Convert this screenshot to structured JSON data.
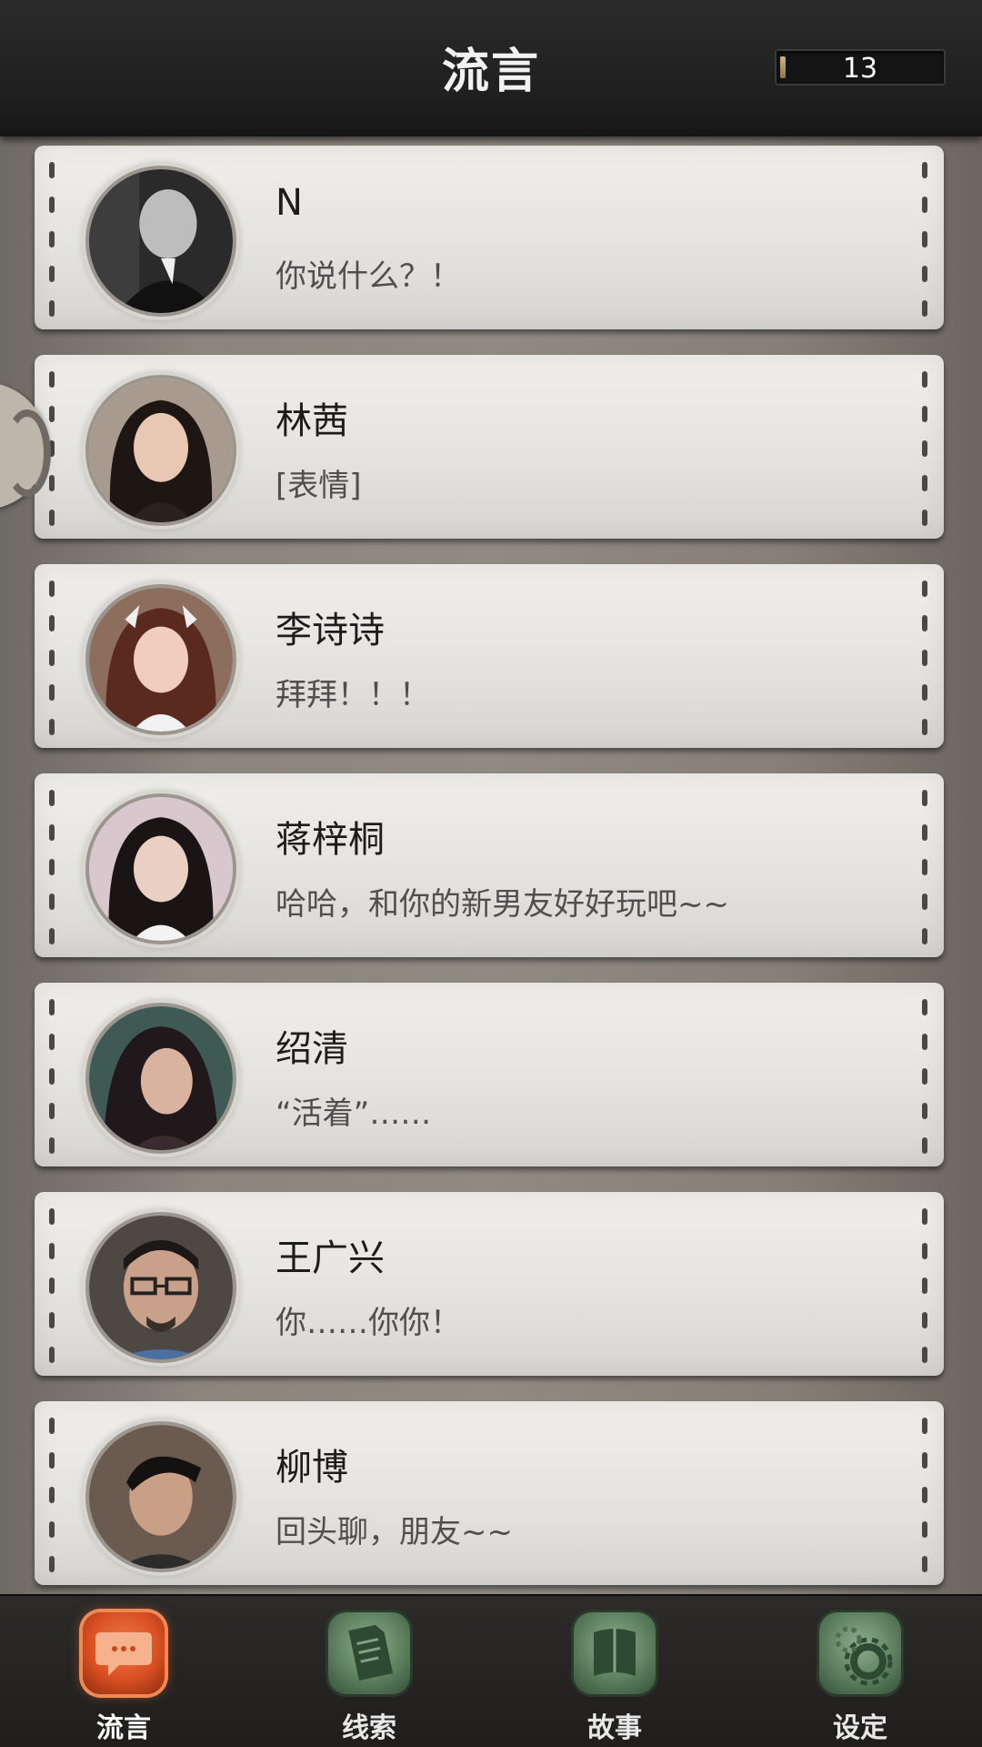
{
  "header": {
    "title": "流言",
    "counter_value": "13",
    "counter_fill": 0.03
  },
  "messages": [
    {
      "name": "N",
      "message": "你说什么？！",
      "avatar": "avatar-n"
    },
    {
      "name": "林茜",
      "message": "[表情]",
      "avatar": "avatar-lin-qian"
    },
    {
      "name": "李诗诗",
      "message": "拜拜！！！",
      "avatar": "avatar-li-shishi"
    },
    {
      "name": "蒋梓桐",
      "message": "哈哈，和你的新男友好好玩吧~~",
      "avatar": "avatar-jiang-zitong"
    },
    {
      "name": "绍清",
      "message": "“活着”……",
      "avatar": "avatar-shao-qing"
    },
    {
      "name": "王广兴",
      "message": "你……你你！",
      "avatar": "avatar-wang-guangxing"
    },
    {
      "name": "柳博",
      "message": "回头聊，朋友~~",
      "avatar": "avatar-liu-bo"
    }
  ],
  "nav": [
    {
      "label": "流言",
      "icon": "chat-bubble-icon",
      "active": true
    },
    {
      "label": "线索",
      "icon": "document-icon",
      "active": false
    },
    {
      "label": "故事",
      "icon": "book-icon",
      "active": false
    },
    {
      "label": "设定",
      "icon": "gear-icon",
      "active": false
    }
  ],
  "colors": {
    "accent_active": "#d94f22",
    "nav_inactive": "#5c7f5e",
    "header_bg": "#1f1f1f",
    "card_bg": "#e5e3df"
  }
}
